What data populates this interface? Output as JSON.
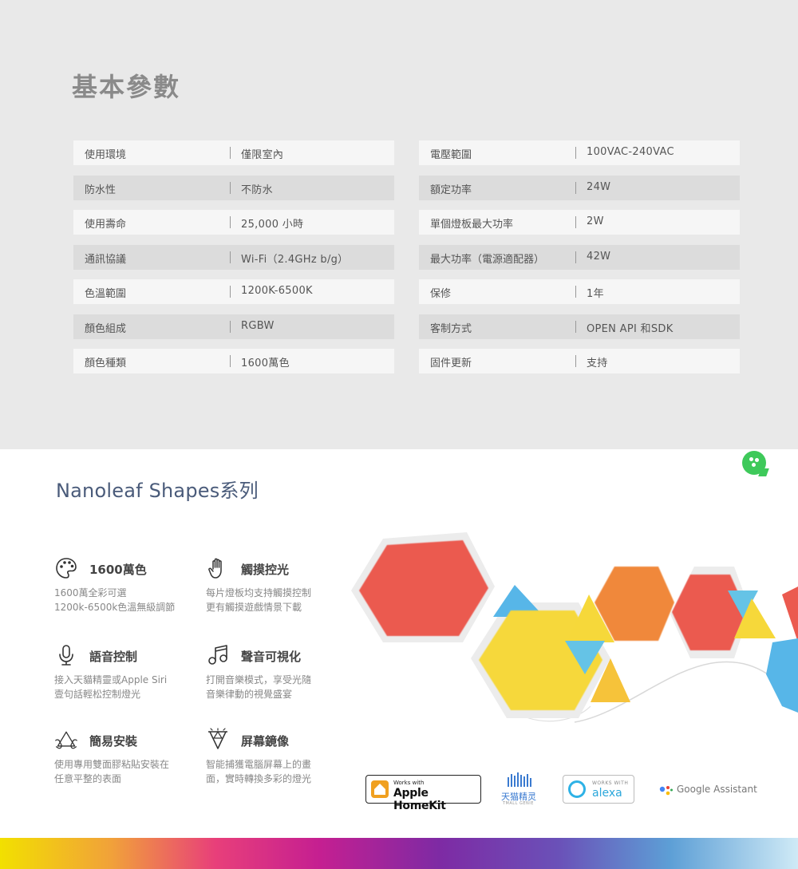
{
  "spec": {
    "title": "基本參數",
    "left": [
      {
        "label": "使用環境",
        "value": "僅限室內"
      },
      {
        "label": "防水性",
        "value": "不防水"
      },
      {
        "label": "使用壽命",
        "value": "25,000 小時"
      },
      {
        "label": "通訊協議",
        "value": "Wi-Fi（2.4GHz b/g）"
      },
      {
        "label": "色溫範圍",
        "value": "1200K-6500K"
      },
      {
        "label": "顏色組成",
        "value": "RGBW"
      },
      {
        "label": "顏色種類",
        "value": "1600萬色"
      }
    ],
    "right": [
      {
        "label": "電壓範圍",
        "value": "100VAC-240VAC"
      },
      {
        "label": "額定功率",
        "value": "24W"
      },
      {
        "label": "單個燈板最大功率",
        "value": "2W"
      },
      {
        "label": "最大功率（電源適配器）",
        "value": "42W"
      },
      {
        "label": "保修",
        "value": "1年"
      },
      {
        "label": "客制方式",
        "value": "OPEN API 和SDK"
      },
      {
        "label": "固件更新",
        "value": "支持"
      }
    ]
  },
  "series": {
    "title": "Nanoleaf Shapes系列"
  },
  "features": [
    {
      "icon": "palette-icon",
      "title": "1600萬色",
      "line1": "1600萬全彩可選",
      "line2": "1200k-6500k色溫無級調節"
    },
    {
      "icon": "touch-hand-icon",
      "title": "觸摸控光",
      "line1": "每片燈板均支持觸摸控制",
      "line2": "更有觸摸遊戲情景下載"
    },
    {
      "icon": "microphone-icon",
      "title": "語音控制",
      "line1": "接入天貓精靈或Apple Siri",
      "line2": "壹句話輕松控制燈光"
    },
    {
      "icon": "music-note-icon",
      "title": "聲音可視化",
      "line1": "打開音樂模式，享受光隨",
      "line2": "音樂律動的視覺盛宴"
    },
    {
      "icon": "hands-install-icon",
      "title": "簡易安裝",
      "line1": "使用專用雙面膠粘貼安裝在",
      "line2": "任意平整的表面"
    },
    {
      "icon": "screen-mirror-icon",
      "title": "屏幕鏡像",
      "line1": "智能捕獲電腦屏幕上的畫",
      "line2": "面，實時轉換多彩的燈光"
    }
  ],
  "badges": {
    "homekit_small": "Works with",
    "homekit_big": "Apple HomeKit",
    "tmall_main": "天猫精灵",
    "tmall_sub": "TMALL GENIE",
    "alexa_small": "WORKS WITH",
    "alexa_big": "alexa",
    "google": "Google Assistant"
  },
  "colors": {
    "spec_bg": "#e9e9e9",
    "title_gray": "#8a8a8a",
    "series_blue": "#4a5b7a",
    "chat_green": "#3ec95a",
    "panel_red": "#eb5a4f",
    "panel_yellow": "#f6d83a",
    "panel_orange": "#f0883a",
    "panel_blue": "#57b6e8"
  }
}
